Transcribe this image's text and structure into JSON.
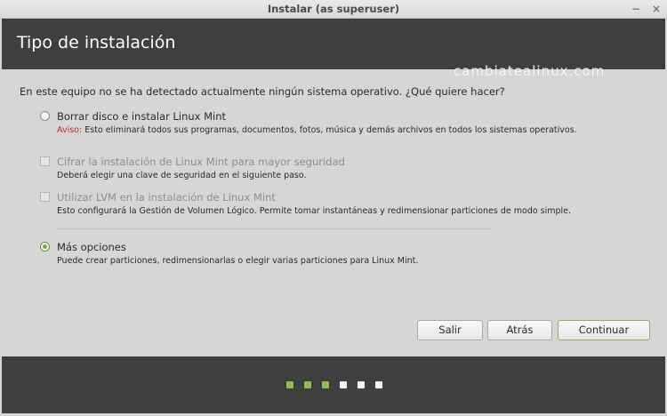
{
  "window": {
    "title": "Instalar (as superuser)",
    "minimize_glyph": "−",
    "close_glyph": "×"
  },
  "header": {
    "title": "Tipo de instalación"
  },
  "watermark": "cambiatealinux.com",
  "question": "En este equipo no se ha detectado actualmente ningún sistema operativo. ¿Qué quiere hacer?",
  "options": [
    {
      "label": "Borrar disco e instalar Linux Mint",
      "warning_prefix": "Aviso:",
      "description": " Esto eliminará todos sus programas, documentos, fotos, música y demás archivos en todos los sistemas operativos.",
      "control": "radio",
      "selected": false,
      "enabled": true
    },
    {
      "label": "Cifrar la instalación de Linux Mint para mayor seguridad",
      "description": "Deberá elegir una clave de seguridad en el siguiente paso.",
      "control": "checkbox",
      "checked": false,
      "enabled": false
    },
    {
      "label": "Utilizar LVM en la instalación de Linux Mint",
      "description": "Esto configurará la Gestión de Volumen Lógico. Permite tomar instantáneas y redimensionar particiones de modo simple.",
      "control": "checkbox",
      "checked": false,
      "enabled": false
    },
    {
      "label": "Más opciones",
      "description": "Puede crear particiones, redimensionarlas o elegir varias particiones para Linux Mint.",
      "control": "radio",
      "selected": true,
      "enabled": true
    }
  ],
  "buttons": {
    "quit": "Salir",
    "back": "Atrás",
    "continue": "Continuar"
  },
  "progress": {
    "total_steps": 6,
    "completed_steps": 3,
    "completed_color": "#8fbf4c",
    "pending_color": "#f2f2f2"
  },
  "colors": {
    "header_bg": "#3f3f3f",
    "accent": "#7fa34a",
    "warning": "#c62828"
  }
}
